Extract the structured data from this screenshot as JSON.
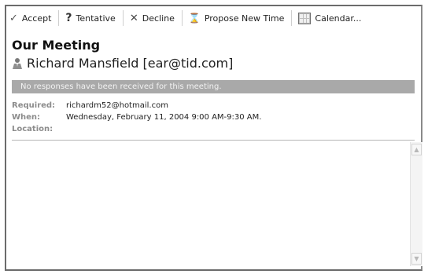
{
  "toolbar": {
    "accept": {
      "label": "Accept",
      "icon": "check-icon"
    },
    "tentative": {
      "label": "Tentative",
      "icon": "question-icon"
    },
    "decline": {
      "label": "Decline",
      "icon": "x-icon"
    },
    "propose": {
      "label": "Propose New Time",
      "icon": "clock-icon"
    },
    "calendar": {
      "label": "Calendar...",
      "icon": "calendar-icon"
    }
  },
  "meeting": {
    "subject": "Our Meeting",
    "organizer": "Richard Mansfield [ear@tid.com]",
    "info_bar": "No responses have been received for this meeting.",
    "required_label": "Required:",
    "required_value": "richardm52@hotmail.com",
    "when_label": "When:",
    "when_value": "Wednesday, February 11, 2004 9:00 AM-9:30 AM.",
    "location_label": "Location:",
    "location_value": ""
  },
  "colors": {
    "info_bar_bg": "#a9a9a9",
    "label_gray": "#8c8c8c",
    "frame_border": "#6b6b6b"
  }
}
